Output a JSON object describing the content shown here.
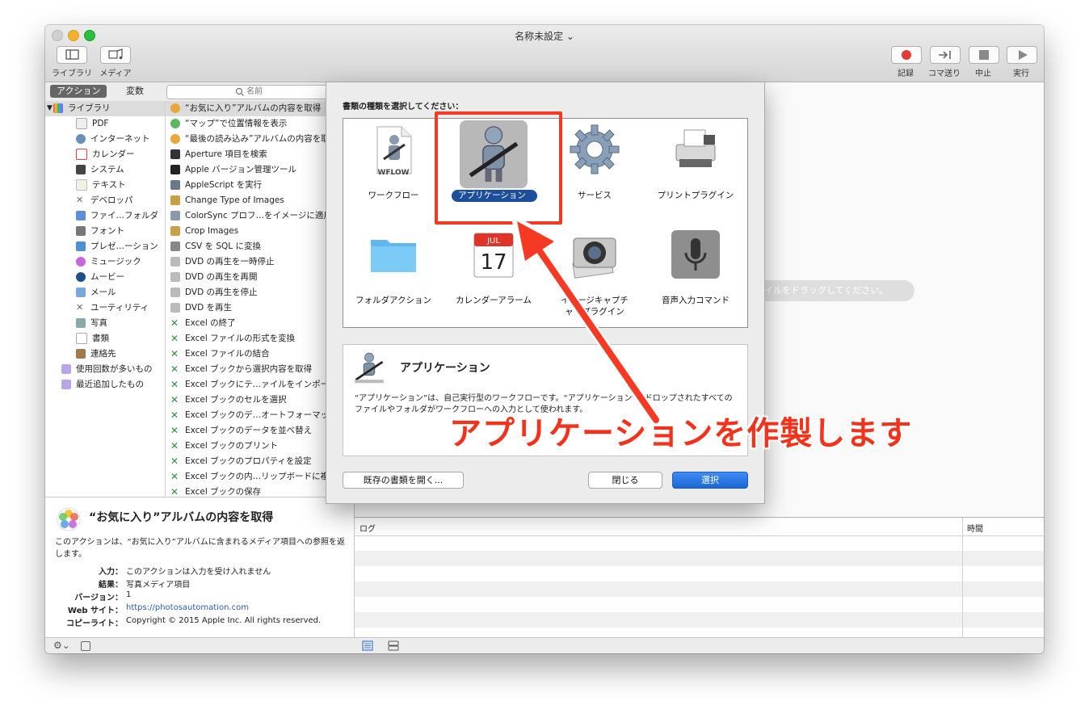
{
  "window": {
    "title": "名称未設定 ⌄"
  },
  "toolbar": {
    "library_label": "ライブラリ",
    "media_label": "メディア",
    "record_label": "記録",
    "step_label": "コマ送り",
    "stop_label": "中止",
    "run_label": "実行"
  },
  "tabs": {
    "actions": "アクション",
    "variables": "変数"
  },
  "search": {
    "placeholder": "名前"
  },
  "library": {
    "root": "ライブラリ",
    "items": [
      "PDF",
      "インターネット",
      "カレンダー",
      "システム",
      "テキスト",
      "デベロッパ",
      "ファイ…フォルダ",
      "フォント",
      "プレゼ…ーション",
      "ミュージック",
      "ムービー",
      "メール",
      "ユーティリティ",
      "写真",
      "書類",
      "連絡先"
    ],
    "smart": [
      "使用回数が多いもの",
      "最近追加したもの"
    ]
  },
  "actions": [
    "“お気に入り”アルバムの内容を取得",
    "“マップ”で位置情報を表示",
    "“最後の読み込み”アルバムの内容を取得",
    "Aperture 項目を検索",
    "Apple バージョン管理ツール",
    "AppleScript を実行",
    "Change Type of Images",
    "ColorSync プロフ…をイメージに適用",
    "Crop Images",
    "CSV を SQL に変換",
    "DVD の再生を一時停止",
    "DVD の再生を再開",
    "DVD の再生を停止",
    "DVD を再生",
    "Excel の終了",
    "Excel ファイルの形式を変換",
    "Excel ファイルの結合",
    "Excel ブックから選択内容を取得",
    "Excel ブックにテ…ァイルをインポート",
    "Excel ブックのセルを選択",
    "Excel ブックのデ…オートフォーマット",
    "Excel ブックのデータを並べ替え",
    "Excel ブックのプリント",
    "Excel ブックのプロパティを設定",
    "Excel ブックの内…リップボードに複製",
    "Excel ブックの保存"
  ],
  "info": {
    "title": "“お気に入り”アルバムの内容を取得",
    "description": "このアクションは、“お気に入り”アルバムに含まれるメディア項目への参照を返します。",
    "fields": [
      {
        "key": "入力：",
        "value": "このアクションは入力を受け入れません"
      },
      {
        "key": "結果：",
        "value": "写真メディア項目"
      },
      {
        "key": "バージョン：",
        "value": "1"
      },
      {
        "key": "Web サイト：",
        "value": "https://photosautomation.com"
      },
      {
        "key": "コピーライト：",
        "value": "Copyright © 2015 Apple Inc. All rights reserved."
      }
    ]
  },
  "workflow": {
    "drop_hint": "イルをドラッグしてください。"
  },
  "log": {
    "col_log": "ログ",
    "col_time": "時間"
  },
  "sheet": {
    "prompt": "書類の種類を選択してください：",
    "types": [
      {
        "label": "ワークフロー",
        "icon": "workflow-doc-icon"
      },
      {
        "label": "アプリケーション",
        "icon": "automator-robot-icon",
        "selected": true
      },
      {
        "label": "サービス",
        "icon": "gear-icon"
      },
      {
        "label": "プリントプラグイン",
        "icon": "printer-icon"
      },
      {
        "label": "フォルダアクション",
        "icon": "folder-icon"
      },
      {
        "label": "カレンダーアラーム",
        "icon": "calendar-icon",
        "cal_month": "JUL",
        "cal_day": "17"
      },
      {
        "label": "イメージキャプチャ・プラグイン",
        "icon": "camera-icon"
      },
      {
        "label": "音声入力コマンド",
        "icon": "microphone-icon"
      }
    ],
    "doc_badge": "WFLOW",
    "detail_title": "アプリケーション",
    "detail_text": "“アプリケーション”は、自己実行型のワークフローです。“アプリケーション”にドロップされたすべてのファイルやフォルダがワークフローへの入力として使われます。",
    "open_existing": "既存の書類を開く...",
    "close": "閉じる",
    "choose": "選択"
  },
  "annotation": {
    "text": "アプリケーションを作製します",
    "color": "#f4311b"
  }
}
